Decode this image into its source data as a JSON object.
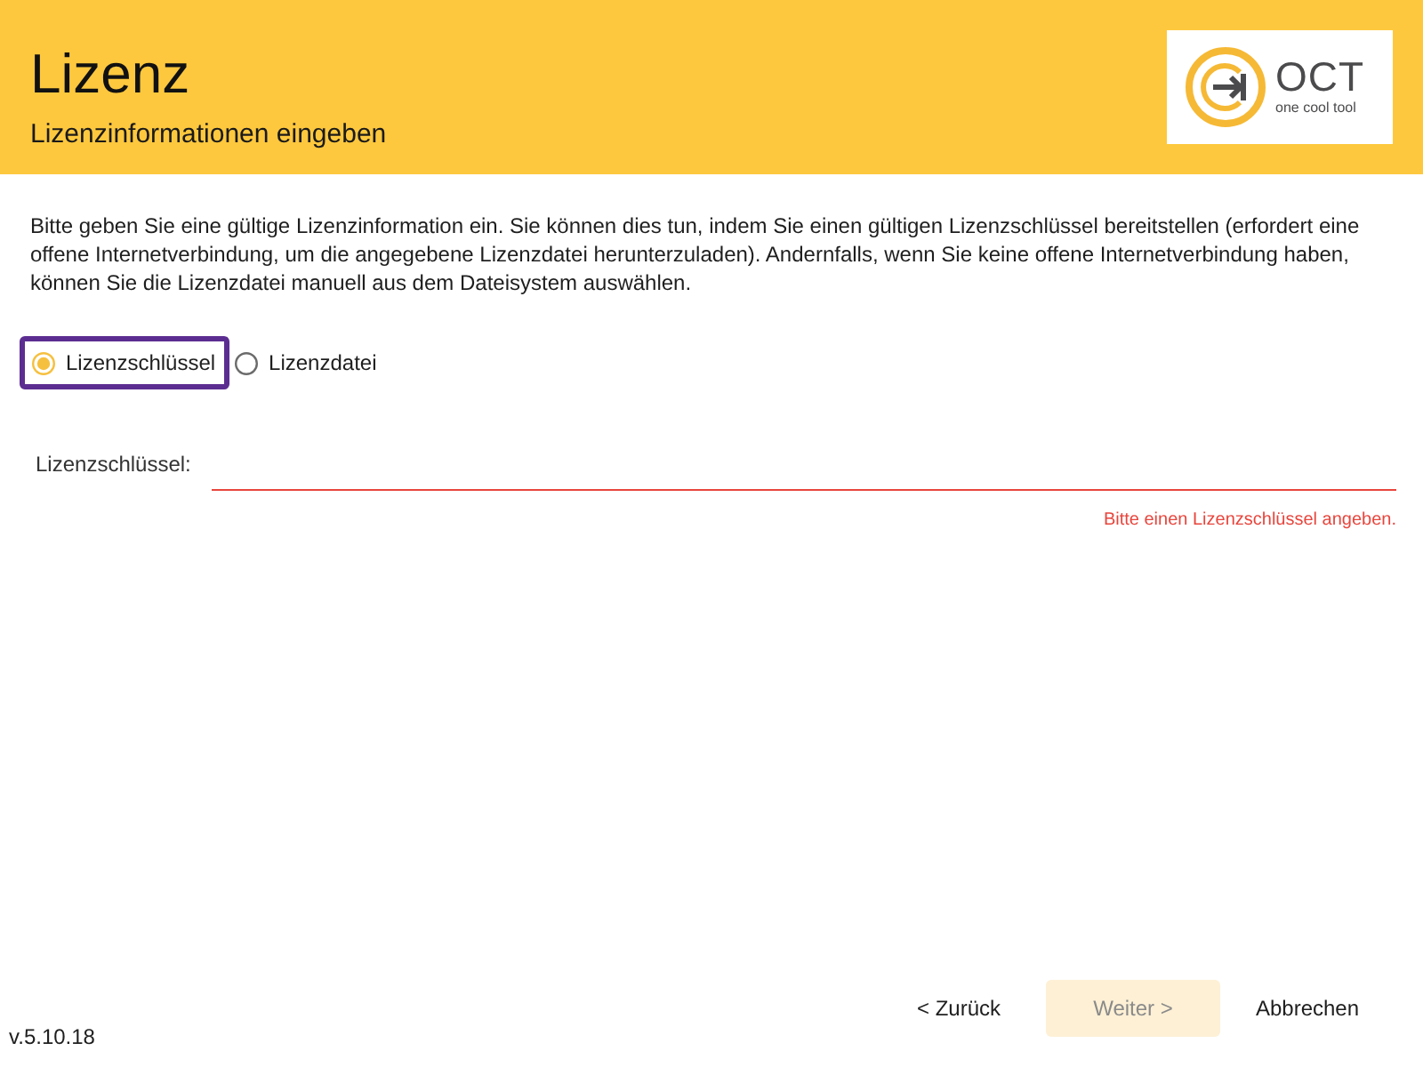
{
  "header": {
    "title": "Lizenz",
    "subtitle": "Lizenzinformationen eingeben",
    "logo": {
      "wordmark": "OCT",
      "tagline": "one cool tool"
    }
  },
  "description": "Bitte geben Sie eine gültige Lizenzinformation ein. Sie können dies tun, indem Sie einen gültigen Lizenzschlüssel bereitstellen (erfordert eine offene Internetverbindung, um die angegebene Lizenzdatei herunterzuladen). Andernfalls, wenn Sie keine offene Internetverbindung haben, können Sie die Lizenzdatei manuell aus dem Dateisystem auswählen.",
  "license_type": [
    {
      "label": "Lizenzschlüssel",
      "selected": true,
      "focused": true
    },
    {
      "label": "Lizenzdatei",
      "selected": false,
      "focused": false
    }
  ],
  "license_key": {
    "label": "Lizenzschlüssel:",
    "invalid": true,
    "error": "Bitte einen Lizenzschlüssel angeben."
  },
  "version": "v.5.10.18",
  "buttons": [
    {
      "label": "< Zurück",
      "kind": "plain",
      "disabled": false
    },
    {
      "label": "Weiter >",
      "kind": "primary",
      "disabled": true
    },
    {
      "label": "Abbrechen",
      "kind": "plain",
      "disabled": false
    }
  ]
}
